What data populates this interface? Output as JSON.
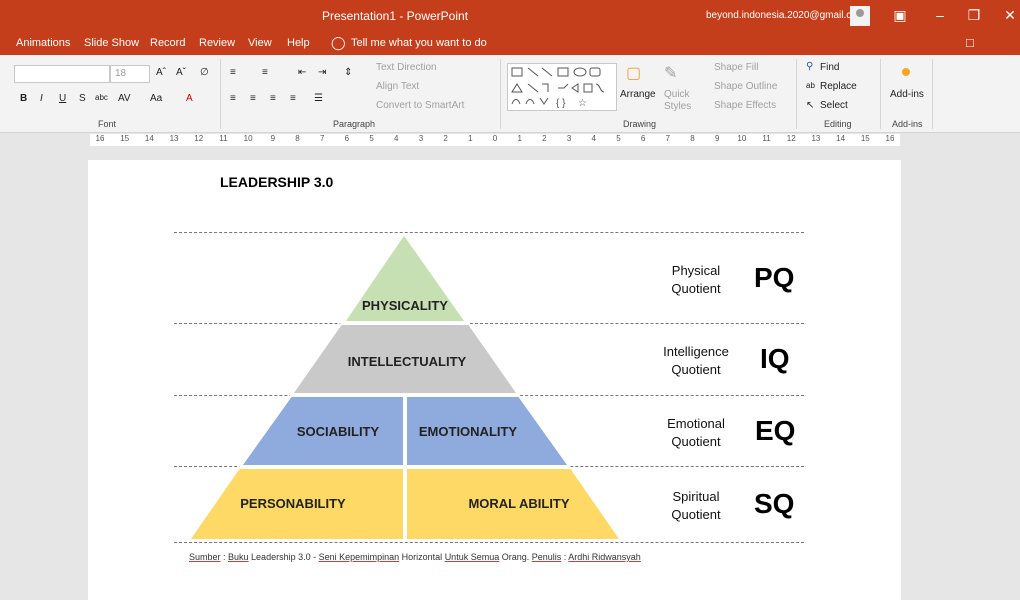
{
  "window": {
    "title": "Presentation1  -  PowerPoint",
    "account": "beyond.indonesia.2020@gmail.com"
  },
  "menu": [
    "Animations",
    "Slide Show",
    "Record",
    "Review",
    "View",
    "Help"
  ],
  "tell_me": "Tell me what you want to do",
  "ribbon": {
    "font_size": "18",
    "font_group": "Font",
    "paragraph_group": "Paragraph",
    "drawing_group": "Drawing",
    "editing_group": "Editing",
    "addins_group": "Add-ins",
    "text_direction": "Text Direction",
    "align_text": "Align Text",
    "convert_smartart": "Convert to SmartArt",
    "arrange": "Arrange",
    "quick_styles": "Quick Styles",
    "shape_fill": "Shape Fill",
    "shape_outline": "Shape Outline",
    "shape_effects": "Shape Effects",
    "find": "Find",
    "replace": "Replace",
    "select": "Select",
    "addins": "Add-ins"
  },
  "ruler": [
    "16",
    "15",
    "14",
    "13",
    "12",
    "11",
    "10",
    "9",
    "8",
    "7",
    "6",
    "5",
    "4",
    "3",
    "2",
    "1",
    "0",
    "1",
    "2",
    "3",
    "4",
    "5",
    "6",
    "7",
    "8",
    "9",
    "10",
    "11",
    "12",
    "13",
    "14",
    "15",
    "16"
  ],
  "slide": {
    "title": "LEADERSHIP 3.0",
    "levels": {
      "physicality": "PHYSICALITY",
      "intellectuality": "INTELLECTUALITY",
      "sociability": "SOCIABILITY",
      "emotionality": "EMOTIONALITY",
      "personability": "PERSONABILITY",
      "moral_ability": "MORAL ABILITY"
    },
    "quotients": [
      {
        "line1": "Physical",
        "line2": "Quotient",
        "abbr": "PQ"
      },
      {
        "line1": "Intelligence",
        "line2": "Quotient",
        "abbr": "IQ"
      },
      {
        "line1": "Emotional",
        "line2": "Quotient",
        "abbr": "EQ"
      },
      {
        "line1": "Spiritual",
        "line2": "Quotient",
        "abbr": "SQ"
      }
    ],
    "source": {
      "a": "Sumber",
      "b": " : ",
      "c": "Buku",
      "d": " Leadership 3.0 - ",
      "e": "Seni Kepemimpinan",
      "f": " Horizontal ",
      "g": "Untuk Semua",
      "h": " Orang. ",
      "i": "Penulis",
      "j": " : ",
      "k": "Ardhi Ridwansyah"
    },
    "colors": {
      "green": "#c6e0b4",
      "gray": "#c9c9c9",
      "blue": "#8faadc",
      "yellow": "#ffd966"
    }
  }
}
